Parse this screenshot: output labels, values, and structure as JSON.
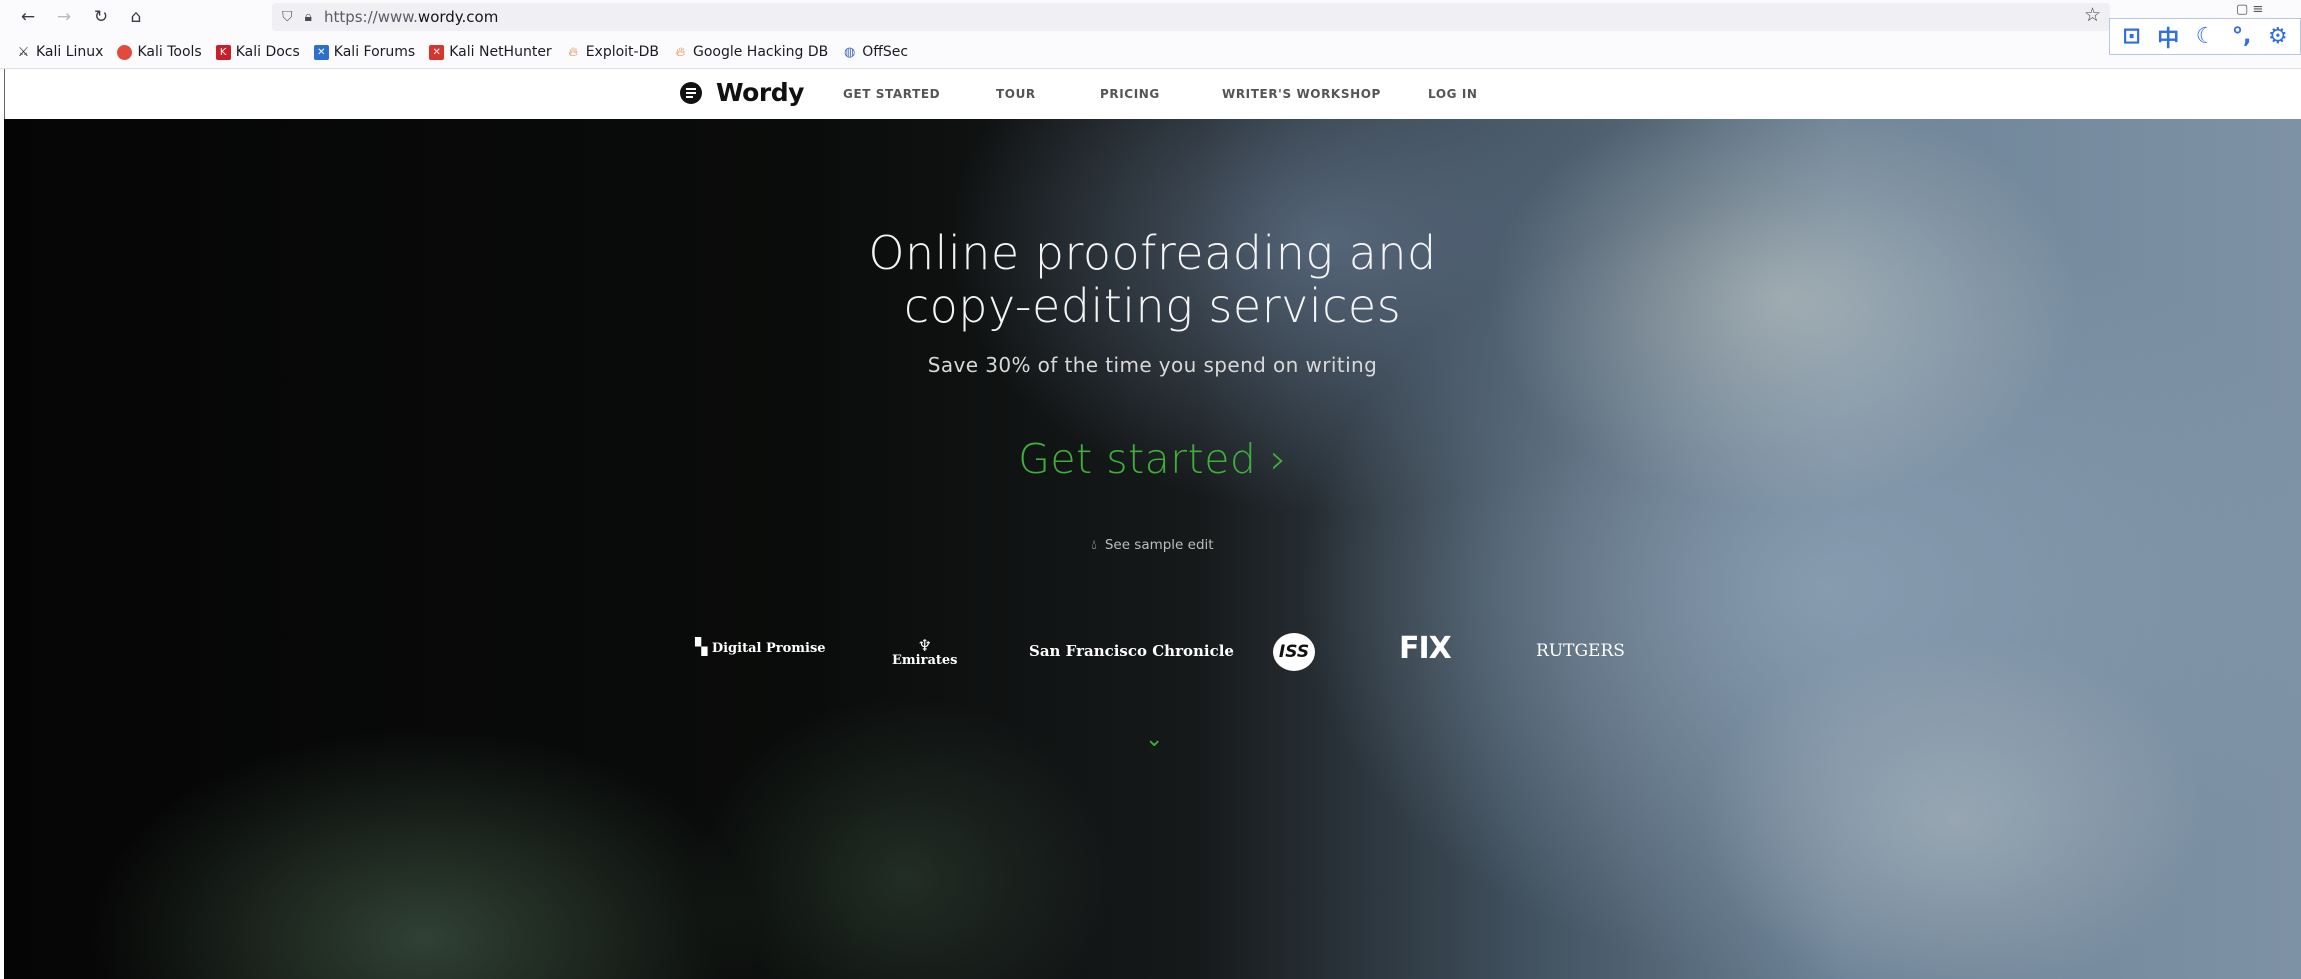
{
  "browser": {
    "url_prefix": "https://www.",
    "url_domain": "wordy.com",
    "bookmarks": [
      {
        "label": "Kali Linux",
        "icon": "kali-dragon-icon"
      },
      {
        "label": "Kali Tools",
        "icon": "kali-tools-icon"
      },
      {
        "label": "Kali Docs",
        "icon": "kali-docs-icon"
      },
      {
        "label": "Kali Forums",
        "icon": "kali-forums-icon"
      },
      {
        "label": "Kali NetHunter",
        "icon": "kali-nethunter-icon"
      },
      {
        "label": "Exploit-DB",
        "icon": "exploit-db-icon"
      },
      {
        "label": "Google Hacking DB",
        "icon": "ghdb-icon"
      },
      {
        "label": "OffSec",
        "icon": "offsec-icon"
      }
    ],
    "extension_icons": [
      "screenshot-icon",
      "chinese-char-icon",
      "moon-icon",
      "comma-icon",
      "gear-icon"
    ],
    "extension_chars": {
      "chinese": "中"
    }
  },
  "site": {
    "logo_text": "Wordy",
    "nav": [
      "GET STARTED",
      "TOUR",
      "PRICING",
      "WRITER'S WORKSHOP",
      "LOG IN"
    ]
  },
  "hero": {
    "title_line1": "Online proofreading and",
    "title_line2": "copy-editing services",
    "subtitle": "Save 30% of the time you spend on writing",
    "cta": "Get started ›",
    "sample_link": "See sample edit",
    "client_logos": [
      "Digital Promise",
      "Emirates",
      "San Francisco Chronicle",
      "ISS",
      "FIX",
      "RUTGERS"
    ]
  },
  "colors": {
    "accent_green": "#3fae3a",
    "hero_text": "#f4f4f4",
    "extension_blue": "#2f6fe0"
  }
}
